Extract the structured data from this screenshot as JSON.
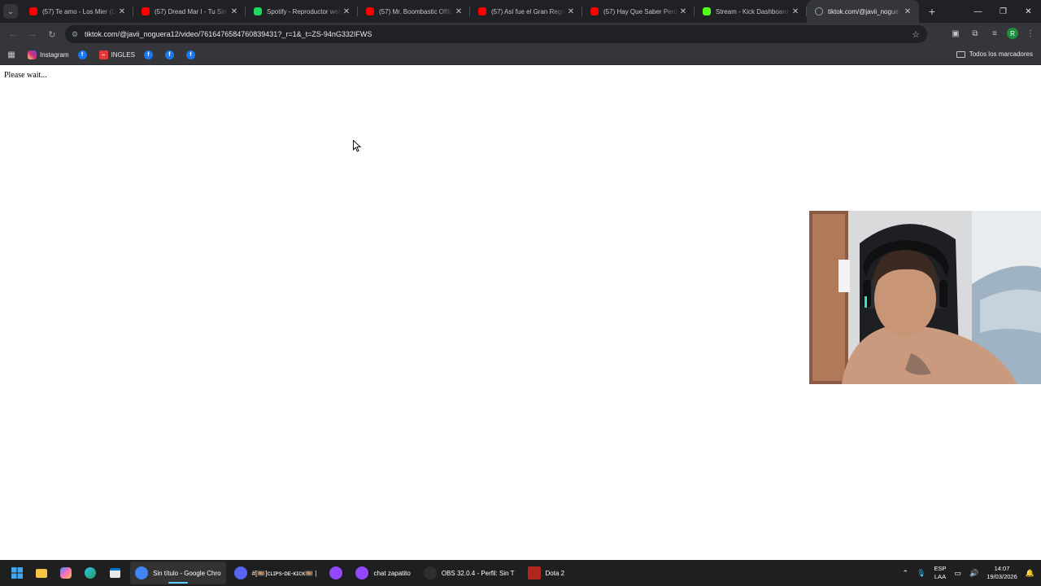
{
  "browser": {
    "tabs": [
      {
        "title": "(57) Te amo - Los Mier (Le",
        "favicon": "youtube-icon",
        "color": "#ff0000"
      },
      {
        "title": "(57) Dread Mar I - Tu Sin",
        "favicon": "youtube-icon",
        "color": "#ff0000"
      },
      {
        "title": "Spotify - Reproductor web",
        "favicon": "spotify-icon",
        "color": "#1ed760"
      },
      {
        "title": "(57) Mr. Boombastic Offic",
        "favicon": "youtube-icon",
        "color": "#ff0000"
      },
      {
        "title": "(57) Así fue el Gran Regre",
        "favicon": "youtube-icon",
        "color": "#ff0000"
      },
      {
        "title": "(57) Hay Que Saber Perde",
        "favicon": "youtube-icon",
        "color": "#ff0000"
      },
      {
        "title": "Stream - Kick Dashboard",
        "favicon": "kick-icon",
        "color": "#53fc18"
      },
      {
        "title": "tiktok.com/@javii_nogue",
        "favicon": "loading-icon",
        "color": "#9aa0a6",
        "active": true
      }
    ],
    "url": "tiktok.com/@javii_noguera12/video/7616476584760839431?_r=1&_t=ZS-94nG332IFWS",
    "profile_initial": "R"
  },
  "bookmarks": {
    "items": [
      {
        "label": "Instagram",
        "icon": "instagram-icon",
        "color": "#e1306c"
      },
      {
        "label": "",
        "icon": "facebook-icon",
        "color": "#1877f2"
      },
      {
        "label": "INGLES",
        "icon": "ingles-icon",
        "color": "#e53935"
      },
      {
        "label": "",
        "icon": "facebook-icon",
        "color": "#1877f2"
      },
      {
        "label": "",
        "icon": "facebook-icon",
        "color": "#1877f2"
      },
      {
        "label": "",
        "icon": "facebook-icon",
        "color": "#1877f2"
      }
    ],
    "all_label": "Todos los marcadores"
  },
  "page": {
    "message": "Please wait..."
  },
  "taskbar": {
    "apps": [
      {
        "label": "Sin título - Google Chro",
        "icon": "chrome-icon",
        "color": "#4285f4",
        "active": true
      },
      {
        "label": "#[🎞️]ᴄʟɪᴘs-ᴅᴇ-ᴋɪᴄᴋ🎞️ |",
        "icon": "discord-icon",
        "color": "#5865f2"
      },
      {
        "label": "",
        "icon": "twitch-icon",
        "color": "#9146ff"
      },
      {
        "label": "chat zapatito",
        "icon": "twitch-icon",
        "color": "#9146ff"
      },
      {
        "label": "OBS 32.0.4 - Perfil: Sin T",
        "icon": "obs-icon",
        "color": "#302e31"
      },
      {
        "label": "Dota 2",
        "icon": "dota-icon",
        "color": "#b0261d"
      }
    ],
    "language": "ESP",
    "layout": "LAA",
    "time": "14:07",
    "date": "19/03/2026"
  }
}
